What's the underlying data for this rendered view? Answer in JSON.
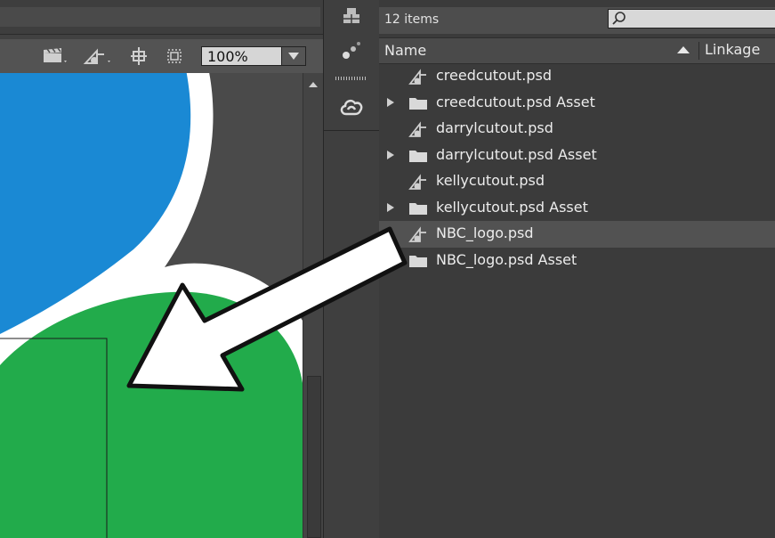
{
  "stage": {
    "zoom_value": "100%",
    "toolbar_icons": [
      "edit-scene-icon",
      "edit-symbol-icon",
      "snap-to-center-icon",
      "clip-stage-icon"
    ]
  },
  "dock": {
    "buttons": [
      "library-panel-icon",
      "motion-presets-icon",
      "creative-cloud-libraries-icon"
    ]
  },
  "library": {
    "item_count": "12 items",
    "search_placeholder": "",
    "columns": {
      "name": "Name",
      "linkage": "Linkage"
    },
    "items": [
      {
        "label": "creedcutout.psd",
        "kind": "bitmap",
        "expandable": false,
        "selected": false
      },
      {
        "label": "creedcutout.psd Asset",
        "kind": "folder",
        "expandable": true,
        "selected": false
      },
      {
        "label": "darrylcutout.psd",
        "kind": "bitmap",
        "expandable": false,
        "selected": false
      },
      {
        "label": "darrylcutout.psd Asset",
        "kind": "folder",
        "expandable": true,
        "selected": false
      },
      {
        "label": "kellycutout.psd",
        "kind": "bitmap",
        "expandable": false,
        "selected": false
      },
      {
        "label": "kellycutout.psd Asset",
        "kind": "folder",
        "expandable": true,
        "selected": false
      },
      {
        "label": "NBC_logo.psd",
        "kind": "bitmap",
        "expandable": false,
        "selected": true
      },
      {
        "label": "NBC_logo.psd Asset",
        "kind": "folder",
        "expandable": true,
        "selected": false
      }
    ]
  },
  "colors": {
    "logo_blue": "#1a89d4",
    "logo_green": "#22ab4b",
    "panel_dark": "#3b3b3b"
  }
}
